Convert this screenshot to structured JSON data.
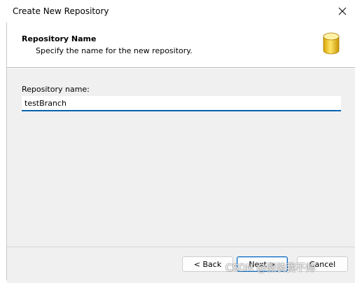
{
  "window": {
    "title": "Create New Repository",
    "close_icon": "close-icon"
  },
  "header": {
    "title": "Repository Name",
    "subtitle": "Specify the name for the new repository.",
    "icon": "database-icon",
    "icon_color": "#f2c318"
  },
  "form": {
    "name_label": "Repository name:",
    "name_value": "testBranch",
    "input_accent_color": "#0063b1"
  },
  "buttons": {
    "back_label": "< Back",
    "next_label": "Next >",
    "cancel_label": "Cancel"
  },
  "watermark": {
    "text": "CSDN @假装我不帅"
  }
}
